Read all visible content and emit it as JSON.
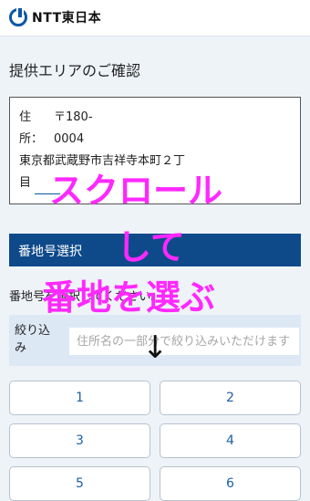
{
  "header": {
    "logo_text": "NTT東日本"
  },
  "page": {
    "section_title": "提供エリアのご確認"
  },
  "address": {
    "label1": "住",
    "postal_line": "〒180-",
    "label2": "所：",
    "postal_line2": "0004",
    "address_line": "東京都武蔵野市吉祥寺本町２丁",
    "address_line2": "目"
  },
  "section": {
    "heading": "番地号選択"
  },
  "instruction": "番地号を選択してください。",
  "filter": {
    "label": "絞り込み",
    "placeholder": "住所名の一部分で絞り込みいただけます"
  },
  "buttons": [
    "1",
    "2",
    "3",
    "4",
    "5",
    "6"
  ],
  "overlay": {
    "line1": "スクロール",
    "line2": "して",
    "line3": "番地を選ぶ",
    "arrow": "↓",
    "color": "#ff28ff"
  },
  "colors": {
    "brand_blue": "#0e4a8a",
    "link_blue": "#1e5fa6",
    "background": "#eef3f8"
  }
}
